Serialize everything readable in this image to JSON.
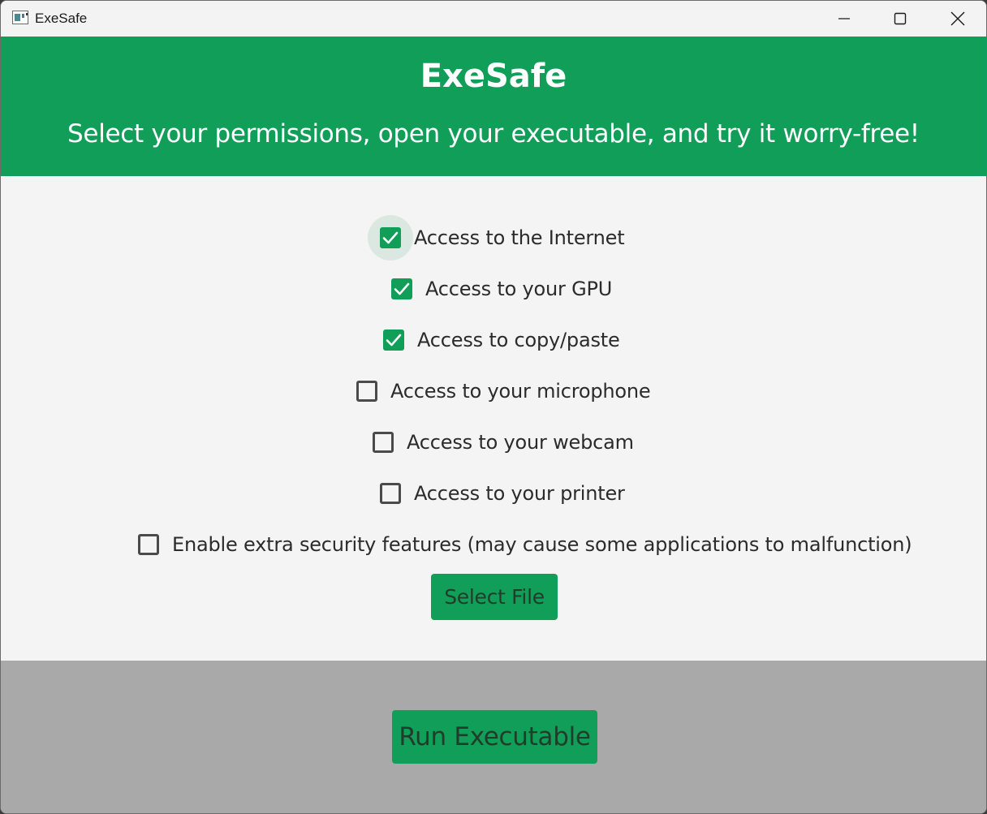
{
  "window": {
    "title": "ExeSafe",
    "controls": {
      "minimize_icon": "minimize-icon",
      "maximize_icon": "maximize-icon",
      "close_icon": "close-icon"
    }
  },
  "header": {
    "title": "ExeSafe",
    "subtitle": "Select your permissions, open your executable, and try it worry-free!",
    "background": "#119e59"
  },
  "permissions": [
    {
      "label": "Access to the Internet",
      "checked": true,
      "focused": true
    },
    {
      "label": "Access to your GPU",
      "checked": true
    },
    {
      "label": "Access to copy/paste",
      "checked": true
    },
    {
      "label": "Access to your microphone",
      "checked": false
    },
    {
      "label": "Access to your webcam",
      "checked": false
    },
    {
      "label": "Access to your printer",
      "checked": false
    },
    {
      "label": "Enable extra security features (may cause some applications to malfunction)",
      "checked": false
    }
  ],
  "actions": {
    "select_file_label": "Select File",
    "run_label": "Run Executable"
  },
  "colors": {
    "accent": "#119e59",
    "content_bg": "#f4f4f4",
    "footer_bg": "#a9a9a9",
    "button_text": "#1f3d2a"
  }
}
